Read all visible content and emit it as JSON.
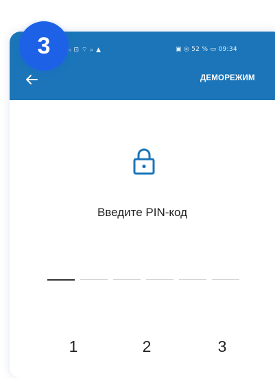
{
  "step": {
    "number": "3"
  },
  "status_bar": {
    "left": "ᵢₗₗ ⊡ ⌔ ⌕ ▲",
    "right": "▣ ◎ 52 % ▭ 09:34"
  },
  "header": {
    "back_icon": "arrow-left-icon",
    "demo_label": "ДЕМОРЕЖИМ",
    "background": "#1b75b8"
  },
  "pin": {
    "lock_icon": "lock-icon",
    "prompt": "Введите PIN-код",
    "length": 6,
    "entered": 0
  },
  "keypad": {
    "keys": [
      "1",
      "2",
      "3"
    ]
  },
  "colors": {
    "accent": "#1b75b8",
    "badge": "#1d62e6"
  }
}
